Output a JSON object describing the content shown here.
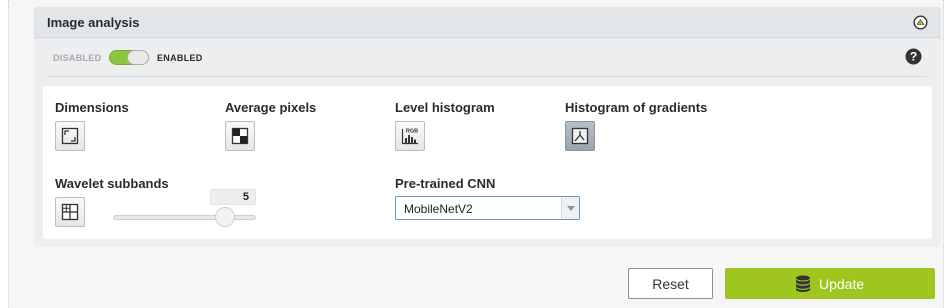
{
  "panel": {
    "title": "Image analysis",
    "toggle": {
      "off_label": "DISABLED",
      "on_label": "ENABLED",
      "state": "enabled"
    }
  },
  "options": {
    "dimensions": {
      "label": "Dimensions",
      "icon": "dimensions-icon"
    },
    "average_pixels": {
      "label": "Average pixels",
      "icon": "average-pixels-icon"
    },
    "level_histogram": {
      "label": "Level histogram",
      "icon": "rgb-histogram-icon",
      "icon_text": "RGB"
    },
    "histogram_gradients": {
      "label": "Histogram of gradients",
      "icon": "gradient-histogram-icon",
      "active": true
    },
    "wavelet_subbands": {
      "label": "Wavelet subbands",
      "icon": "wavelet-grid-icon",
      "value": "5",
      "slider_fraction": 0.78
    },
    "pretrained_cnn": {
      "label": "Pre-trained CNN",
      "selected": "MobileNetV2"
    }
  },
  "actions": {
    "reset": "Reset",
    "update": "Update"
  },
  "colors": {
    "accent": "#9fc61f",
    "toggle_on": "#8cc63f"
  }
}
